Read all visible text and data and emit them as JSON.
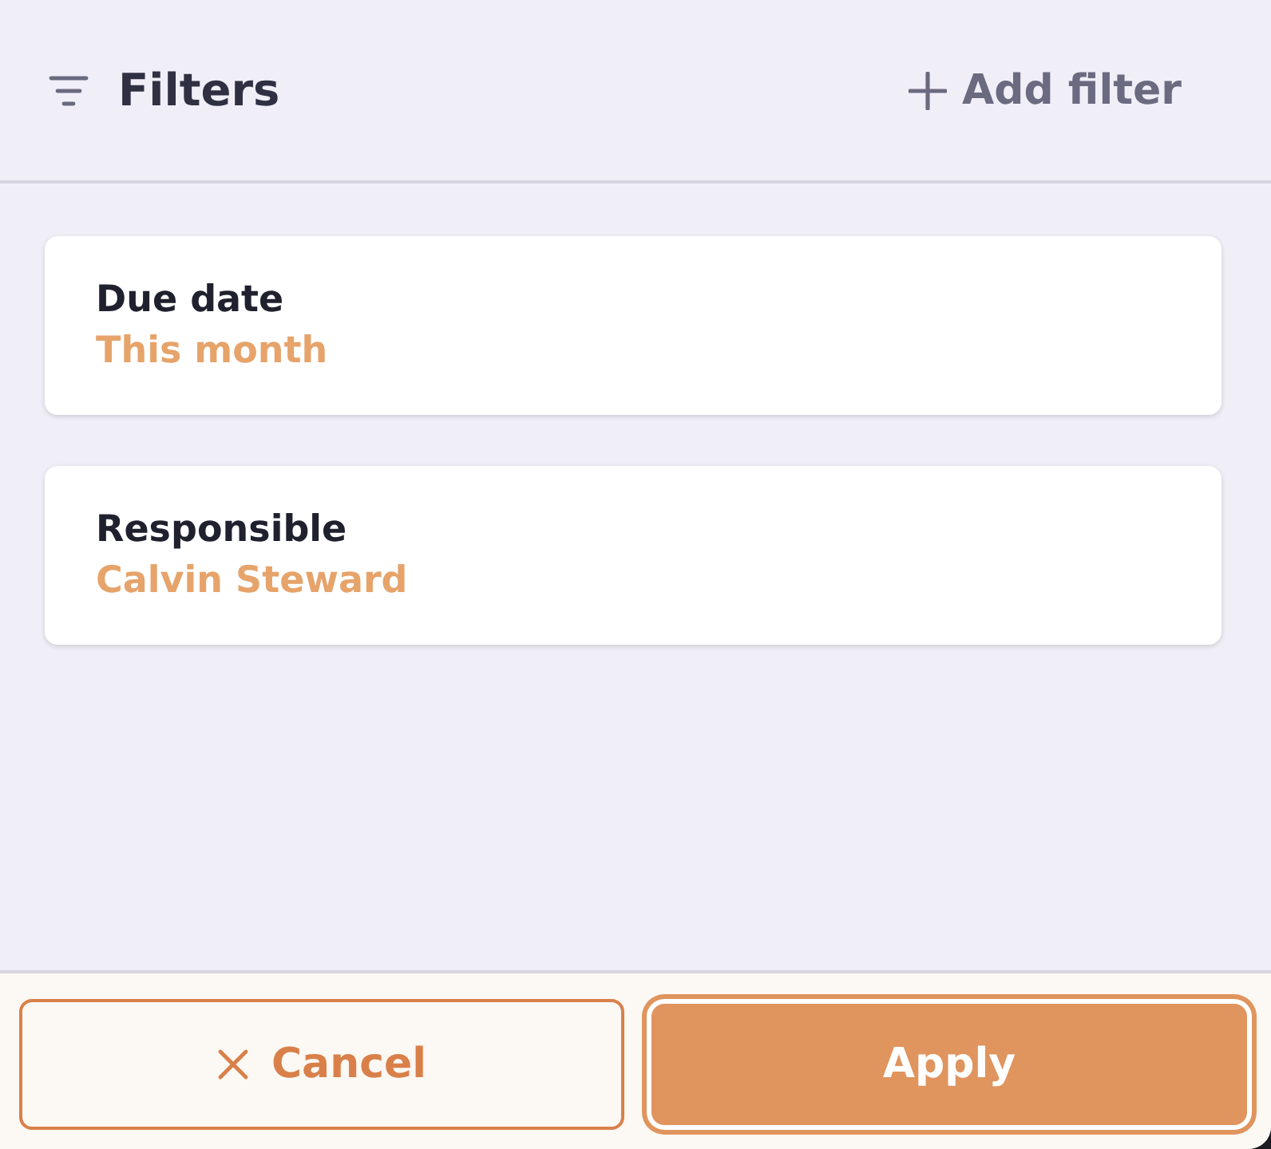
{
  "header": {
    "title": "Filters",
    "action": "Add filter"
  },
  "filters": [
    {
      "label": "Due date",
      "value": "This month"
    },
    {
      "label": "Responsible",
      "value": "Calvin Steward"
    }
  ],
  "buttons": [
    {
      "label": "Cancel",
      "kind": "secondary",
      "focused": false
    },
    {
      "label": "Apply",
      "kind": "primary",
      "focused": true
    }
  ]
}
